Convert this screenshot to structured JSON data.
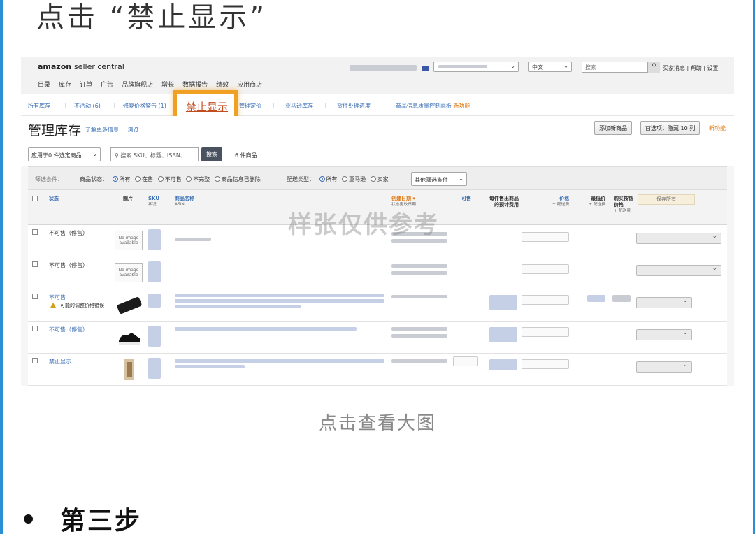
{
  "article": {
    "heading": "点击 “禁止显示”",
    "caption": "点击查看大图",
    "next_step": "第三步"
  },
  "colors": {
    "highlight_border": "#f0a023",
    "link_blue": "#3b6fb5",
    "accent_orange": "#e47911",
    "frame_blue": "#2b8fd6"
  },
  "screenshot": {
    "logo_brand": "amazon",
    "logo_rest": "seller central",
    "top_nav": [
      "目录",
      "库存",
      "订单",
      "广告",
      "品牌旗舰店",
      "增长",
      "数据报告",
      "绩效",
      "应用商店"
    ],
    "language_select": "中文",
    "search_placeholder": "搜索",
    "search_icon": "search-icon",
    "top_links": "买家消息 | 帮助 | 设置",
    "sub_nav": {
      "all_inventory": "所有库存",
      "inactive": "不活动 (6)",
      "price_alert": "修复价格警告 (1)",
      "suppressed": "禁止显示",
      "manage_pricing": "管理定价",
      "amazon_inventory": "亚马逊库存",
      "shipments": "货件处理进度",
      "quality_dashboard": "商品信息质量控制面板",
      "new_tag": "新功能"
    },
    "page_title": "管理库存",
    "learn_more": "了解更多信息",
    "tour": "浏览",
    "add_product_btn": "添加新商品",
    "preferences_btn": "首选项：隐藏 10 列",
    "feedback": "新功能",
    "bulk_action": "应用于0 件选定商品",
    "search_inventory_placeholder": "搜索 SKU、标题、ISBN、",
    "search_btn": "搜索",
    "product_count": "6 件商品",
    "filter_label": "筛选条件：",
    "status_label": "商品状态：",
    "status_options": [
      "所有",
      "在售",
      "不可售",
      "不完整",
      "商品信息已删除"
    ],
    "fulfillment_label": "配送类型：",
    "fulfillment_options": [
      "所有",
      "亚马逊",
      "卖家"
    ],
    "more_filters": "其他筛选条件",
    "table_headers": {
      "status": "状态",
      "image": "图片",
      "sku": "SKU",
      "sku_sub": "状况",
      "name": "商品名称",
      "name_sub": "ASIN",
      "created": "创建日期",
      "created_sub": "状态更改日期",
      "available": "可售",
      "fee": "每件售出商品的预计费用",
      "price": "价格",
      "price_sub": "+ 配送费",
      "min_price": "最低价",
      "min_price_sub": "+ 配送费",
      "buybox": "购买按钮价格",
      "buybox_sub": "+ 配送费",
      "save_all": "保存所有"
    },
    "watermark": "样张仅供参考",
    "rows": [
      {
        "status": "不可售（停售）",
        "image": "No image available",
        "warning": ""
      },
      {
        "status": "不可售（停售）",
        "image": "No image available",
        "warning": ""
      },
      {
        "status": "不可售",
        "image": "power-bank",
        "warning": "可能的调整价格错误"
      },
      {
        "status": "不可售（停售）",
        "image": "shoe",
        "warning": ""
      },
      {
        "status": "禁止显示",
        "image": "figurine",
        "warning": ""
      }
    ]
  }
}
